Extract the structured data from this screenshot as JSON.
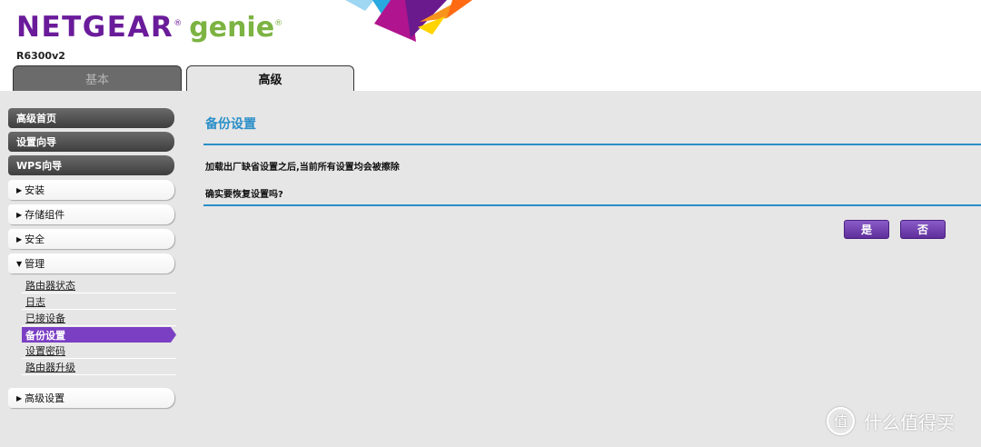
{
  "header": {
    "brand": "NETGEAR",
    "brand_reg": "®",
    "product": "genie",
    "product_reg": "®",
    "model": "R6300v2",
    "tabs": [
      {
        "label": "基本",
        "active": false
      },
      {
        "label": "高级",
        "active": true
      }
    ]
  },
  "sidebar": {
    "primary": [
      {
        "label": "高级首页"
      },
      {
        "label": "设置向导"
      },
      {
        "label": "WPS向导"
      }
    ],
    "sections": [
      {
        "label": "安装",
        "expanded": false
      },
      {
        "label": "存储组件",
        "expanded": false
      },
      {
        "label": "安全",
        "expanded": false
      },
      {
        "label": "管理",
        "expanded": true
      },
      {
        "label": "高级设置",
        "expanded": false
      }
    ],
    "management_items": [
      {
        "label": "路由器状态",
        "active": false
      },
      {
        "label": "日志",
        "active": false
      },
      {
        "label": "已接设备",
        "active": false
      },
      {
        "label": "备份设置",
        "active": true
      },
      {
        "label": "设置密码",
        "active": false
      },
      {
        "label": "路由器升级",
        "active": false
      }
    ],
    "collapsed_icon": "triangle-right-icon",
    "expanded_icon": "triangle-down-icon"
  },
  "main": {
    "title": "备份设置",
    "message": "加载出厂缺省设置之后,当前所有设置均会被擦除",
    "question": "确实要恢复设置吗?",
    "yes_label": "是",
    "no_label": "否"
  },
  "watermark": {
    "icon_text": "值",
    "text": "什么值得买"
  },
  "colors": {
    "accent_blue": "#2a8fc8",
    "active_purple": "#7b3fc4",
    "brand_purple": "#6a1b9a",
    "genie_green": "#7cb342",
    "panel_bg": "#e6e6e6"
  }
}
